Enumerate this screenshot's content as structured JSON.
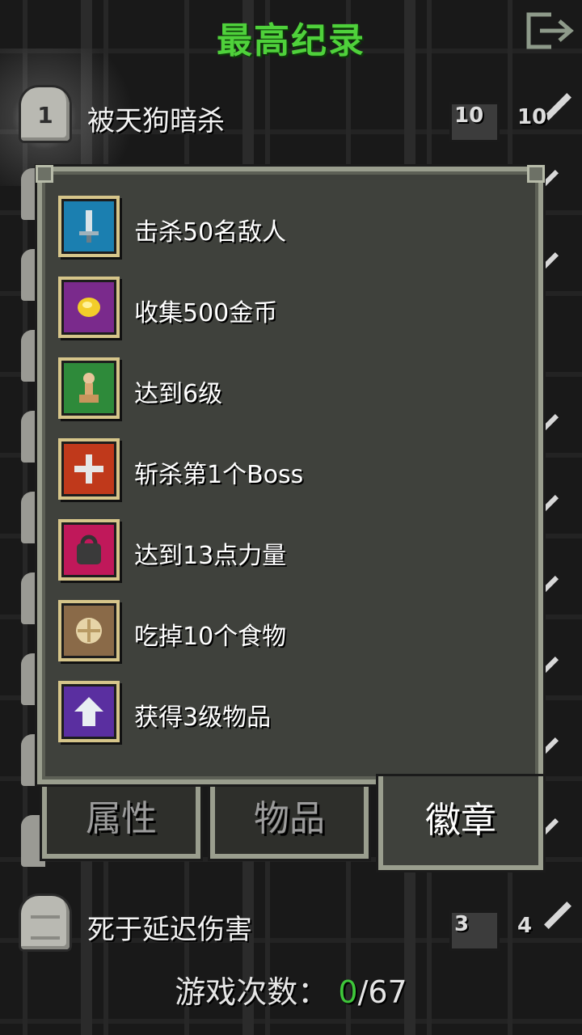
{
  "header": {
    "title": "最高纪录",
    "exit_icon": "exit-icon"
  },
  "records": [
    {
      "rank": "1",
      "text": "被天狗暗杀",
      "level": "10",
      "depth": "10"
    },
    {
      "rank": "",
      "text": "死于延迟伤害",
      "level": "3",
      "depth": "4"
    }
  ],
  "badges": [
    {
      "label": "击杀50名敌人",
      "icon": "sword-badge-icon",
      "color": "#1b7fb0"
    },
    {
      "label": "收集500金币",
      "icon": "gold-coin-badge-icon",
      "color": "#7a2a8c"
    },
    {
      "label": "达到6级",
      "icon": "chess-pawn-badge-icon",
      "color": "#2e8a3a"
    },
    {
      "label": "斩杀第1个Boss",
      "icon": "cross-badge-icon",
      "color": "#c0391b"
    },
    {
      "label": "达到13点力量",
      "icon": "weight-badge-icon",
      "color": "#c0185a"
    },
    {
      "label": "吃掉10个食物",
      "icon": "food-badge-icon",
      "color": "#8a6a48"
    },
    {
      "label": "获得3级物品",
      "icon": "upgrade-arrow-badge-icon",
      "color": "#5a2fa0"
    }
  ],
  "tabs": {
    "attributes": "属性",
    "items": "物品",
    "badges": "徽章",
    "active": "badges"
  },
  "footer": {
    "label": "游戏次数：",
    "current": "0",
    "total": "/67"
  },
  "colors": {
    "title": "#4fd13b",
    "panel": "#3f413c",
    "border": "#9a9e8e",
    "counter": "#3ec63a"
  }
}
